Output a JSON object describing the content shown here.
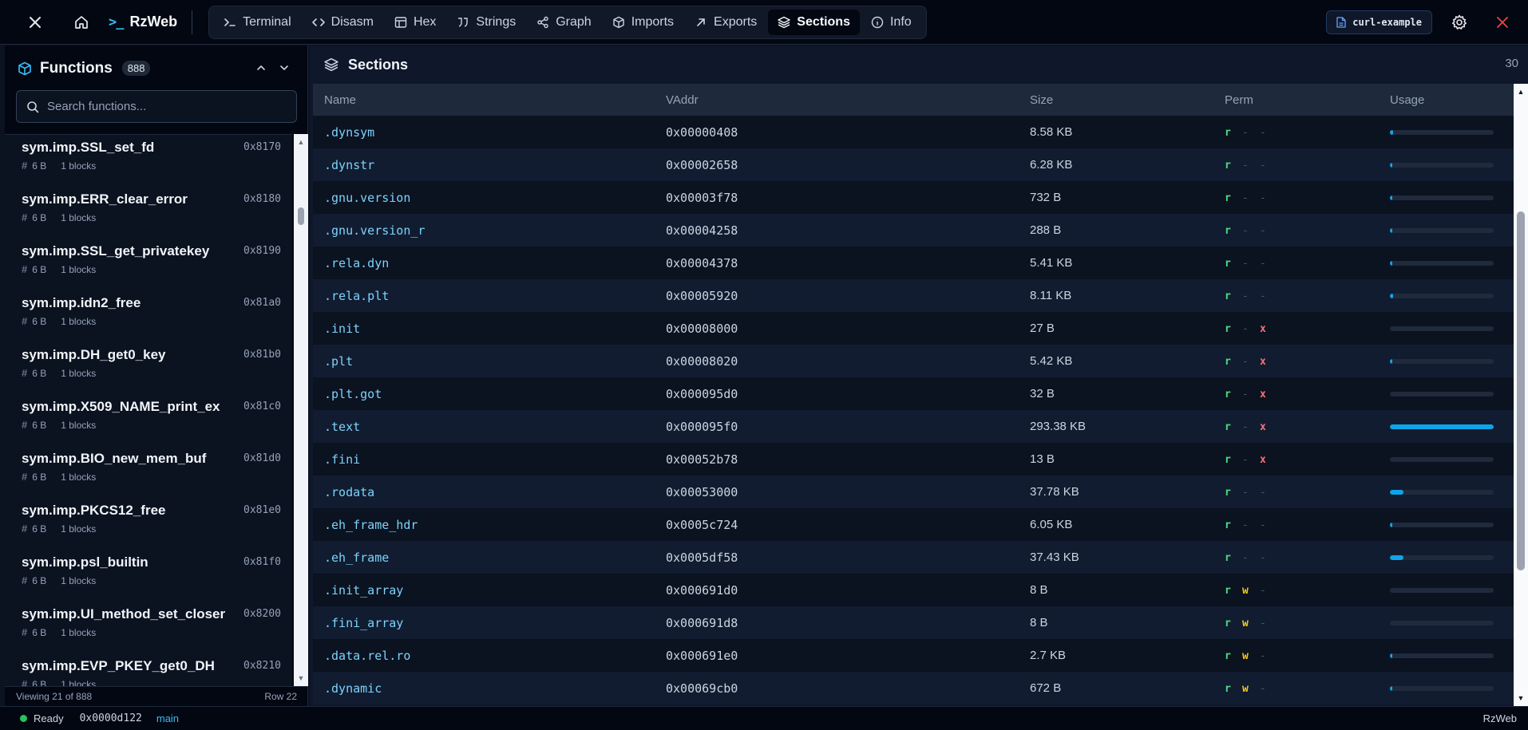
{
  "app": {
    "name": "RzWeb",
    "brand_prompt": ">_",
    "file_name": "curl-example"
  },
  "tabs": [
    {
      "label": "Terminal",
      "icon": "terminal-icon",
      "active": false
    },
    {
      "label": "Disasm",
      "icon": "code-icon",
      "active": false
    },
    {
      "label": "Hex",
      "icon": "table-icon",
      "active": false
    },
    {
      "label": "Strings",
      "icon": "quote-icon",
      "active": false
    },
    {
      "label": "Graph",
      "icon": "share-nodes-icon",
      "active": false
    },
    {
      "label": "Imports",
      "icon": "package-icon",
      "active": false
    },
    {
      "label": "Exports",
      "icon": "arrow-up-right-icon",
      "active": false
    },
    {
      "label": "Sections",
      "icon": "layers-icon",
      "active": true
    },
    {
      "label": "Info",
      "icon": "info-icon",
      "active": false
    }
  ],
  "sidebar": {
    "title": "Functions",
    "count": "888",
    "search_placeholder": "Search functions...",
    "functions": [
      {
        "name": "sym.imp.SSL_set_fd",
        "addr": "0x8170",
        "size": "6 B",
        "blocks": "1 blocks"
      },
      {
        "name": "sym.imp.ERR_clear_error",
        "addr": "0x8180",
        "size": "6 B",
        "blocks": "1 blocks"
      },
      {
        "name": "sym.imp.SSL_get_privatekey",
        "addr": "0x8190",
        "size": "6 B",
        "blocks": "1 blocks"
      },
      {
        "name": "sym.imp.idn2_free",
        "addr": "0x81a0",
        "size": "6 B",
        "blocks": "1 blocks"
      },
      {
        "name": "sym.imp.DH_get0_key",
        "addr": "0x81b0",
        "size": "6 B",
        "blocks": "1 blocks"
      },
      {
        "name": "sym.imp.X509_NAME_print_ex",
        "addr": "0x81c0",
        "size": "6 B",
        "blocks": "1 blocks"
      },
      {
        "name": "sym.imp.BIO_new_mem_buf",
        "addr": "0x81d0",
        "size": "6 B",
        "blocks": "1 blocks"
      },
      {
        "name": "sym.imp.PKCS12_free",
        "addr": "0x81e0",
        "size": "6 B",
        "blocks": "1 blocks"
      },
      {
        "name": "sym.imp.psl_builtin",
        "addr": "0x81f0",
        "size": "6 B",
        "blocks": "1 blocks"
      },
      {
        "name": "sym.imp.UI_method_set_closer",
        "addr": "0x8200",
        "size": "6 B",
        "blocks": "1 blocks"
      },
      {
        "name": "sym.imp.EVP_PKEY_get0_DH",
        "addr": "0x8210",
        "size": "6 B",
        "blocks": "1 blocks"
      }
    ],
    "footer_left": "Viewing 21 of 888",
    "footer_right": "Row 22"
  },
  "main": {
    "title": "Sections",
    "count": "30",
    "columns": [
      "Name",
      "VAddr",
      "Size",
      "Perm",
      "Usage"
    ],
    "rows": [
      {
        "name": ".dynsym",
        "vaddr": "0x00000408",
        "size": "8.58 KB",
        "perm": [
          "r",
          "-",
          "-"
        ],
        "usage": 0.03
      },
      {
        "name": ".dynstr",
        "vaddr": "0x00002658",
        "size": "6.28 KB",
        "perm": [
          "r",
          "-",
          "-"
        ],
        "usage": 0.02
      },
      {
        "name": ".gnu.version",
        "vaddr": "0x00003f78",
        "size": "732 B",
        "perm": [
          "r",
          "-",
          "-"
        ],
        "usage": 0.003
      },
      {
        "name": ".gnu.version_r",
        "vaddr": "0x00004258",
        "size": "288 B",
        "perm": [
          "r",
          "-",
          "-"
        ],
        "usage": 0.001
      },
      {
        "name": ".rela.dyn",
        "vaddr": "0x00004378",
        "size": "5.41 KB",
        "perm": [
          "r",
          "-",
          "-"
        ],
        "usage": 0.018
      },
      {
        "name": ".rela.plt",
        "vaddr": "0x00005920",
        "size": "8.11 KB",
        "perm": [
          "r",
          "-",
          "-"
        ],
        "usage": 0.028
      },
      {
        "name": ".init",
        "vaddr": "0x00008000",
        "size": "27 B",
        "perm": [
          "r",
          "-",
          "x"
        ],
        "usage": 0.0
      },
      {
        "name": ".plt",
        "vaddr": "0x00008020",
        "size": "5.42 KB",
        "perm": [
          "r",
          "-",
          "x"
        ],
        "usage": 0.018
      },
      {
        "name": ".plt.got",
        "vaddr": "0x000095d0",
        "size": "32 B",
        "perm": [
          "r",
          "-",
          "x"
        ],
        "usage": 0.0
      },
      {
        "name": ".text",
        "vaddr": "0x000095f0",
        "size": "293.38 KB",
        "perm": [
          "r",
          "-",
          "x"
        ],
        "usage": 1.0
      },
      {
        "name": ".fini",
        "vaddr": "0x00052b78",
        "size": "13 B",
        "perm": [
          "r",
          "-",
          "x"
        ],
        "usage": 0.0
      },
      {
        "name": ".rodata",
        "vaddr": "0x00053000",
        "size": "37.78 KB",
        "perm": [
          "r",
          "-",
          "-"
        ],
        "usage": 0.129
      },
      {
        "name": ".eh_frame_hdr",
        "vaddr": "0x0005c724",
        "size": "6.05 KB",
        "perm": [
          "r",
          "-",
          "-"
        ],
        "usage": 0.021
      },
      {
        "name": ".eh_frame",
        "vaddr": "0x0005df58",
        "size": "37.43 KB",
        "perm": [
          "r",
          "-",
          "-"
        ],
        "usage": 0.128
      },
      {
        "name": ".init_array",
        "vaddr": "0x000691d0",
        "size": "8 B",
        "perm": [
          "r",
          "w",
          "-"
        ],
        "usage": 0.0
      },
      {
        "name": ".fini_array",
        "vaddr": "0x000691d8",
        "size": "8 B",
        "perm": [
          "r",
          "w",
          "-"
        ],
        "usage": 0.0
      },
      {
        "name": ".data.rel.ro",
        "vaddr": "0x000691e0",
        "size": "2.7 KB",
        "perm": [
          "r",
          "w",
          "-"
        ],
        "usage": 0.009
      },
      {
        "name": ".dynamic",
        "vaddr": "0x00069cb0",
        "size": "672 B",
        "perm": [
          "r",
          "w",
          "-"
        ],
        "usage": 0.002
      }
    ]
  },
  "status": {
    "state": "Ready",
    "address": "0x0000d122",
    "branch": "main",
    "app_label": "RzWeb"
  },
  "colors": {
    "accent": "#38bdf8",
    "perm_read": "#4ade80",
    "perm_write": "#facc15",
    "perm_exec": "#f87171",
    "usage_bar": "#0ea5e9",
    "status_ok": "#22c55e"
  }
}
